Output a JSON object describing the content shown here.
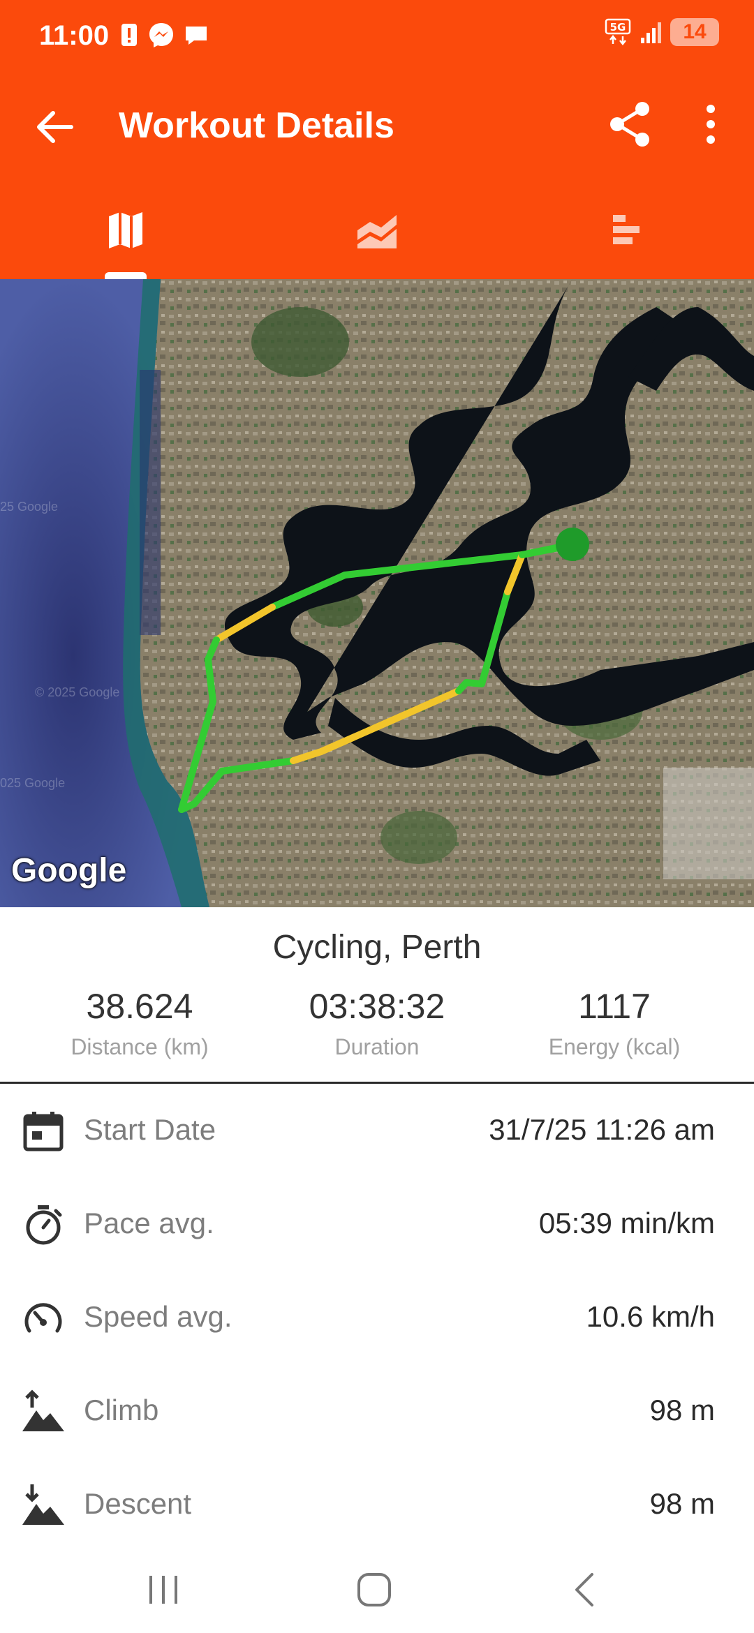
{
  "status_bar": {
    "time": "11:00",
    "battery": "14",
    "network": "5G"
  },
  "toolbar": {
    "title": "Workout Details"
  },
  "tabs": [
    {
      "name": "map"
    },
    {
      "name": "charts"
    },
    {
      "name": "stats"
    }
  ],
  "map": {
    "logo": "Google",
    "watermarks": [
      "25 Google",
      "© 2025 Google",
      "025 Google"
    ],
    "colors": {
      "ocean": "#3f4f95",
      "route_green": "#33cc33",
      "route_yellow": "#f2c52b",
      "start_marker": "#1f9b2a"
    }
  },
  "summary": {
    "title": "Cycling, Perth",
    "stats": [
      {
        "value": "38.624",
        "label": "Distance (km)"
      },
      {
        "value": "03:38:32",
        "label": "Duration"
      },
      {
        "value": "1117",
        "label": "Energy (kcal)"
      }
    ]
  },
  "details": [
    {
      "icon": "calendar-icon",
      "label": "Start Date",
      "value": "31/7/25 11:26 am"
    },
    {
      "icon": "stopwatch-icon",
      "label": "Pace avg.",
      "value": "05:39 min/km"
    },
    {
      "icon": "speedometer-icon",
      "label": "Speed avg.",
      "value": "10.6 km/h"
    },
    {
      "icon": "climb-icon",
      "label": "Climb",
      "value": "98 m"
    },
    {
      "icon": "descent-icon",
      "label": "Descent",
      "value": "98 m"
    }
  ],
  "colors": {
    "accent": "#fb4a0c",
    "label_grey": "#7d7d7d"
  }
}
